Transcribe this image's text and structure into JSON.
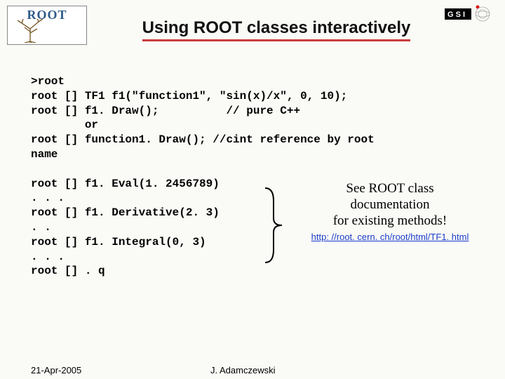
{
  "logo": {
    "text": "ROOT"
  },
  "title": "Using ROOT classes interactively",
  "code": {
    "l1": ">root",
    "l2": "root [] TF1 f1(\"function1\", \"sin(x)/x\", 0, 10);",
    "l3": "root [] f1. Draw();          // pure C++",
    "l4": "        or",
    "l5": "root [] function1. Draw(); //cint reference by root",
    "l6": "name",
    "l7": "",
    "l8": "root [] f1. Eval(1. 2456789)",
    "l9": ". . .",
    "l10": "root [] f1. Derivative(2. 3)",
    "l11": ". .",
    "l12": "root [] f1. Integral(0, 3)",
    "l13": ". . .",
    "l14": "root [] . q"
  },
  "side": {
    "see1": "See ROOT class",
    "see2": "documentation",
    "see3": "for existing methods!",
    "url": "http: //root. cern. ch/root/html/TF1. html"
  },
  "footer": {
    "date": "21-Apr-2005",
    "author": "J. Adamczewski"
  }
}
